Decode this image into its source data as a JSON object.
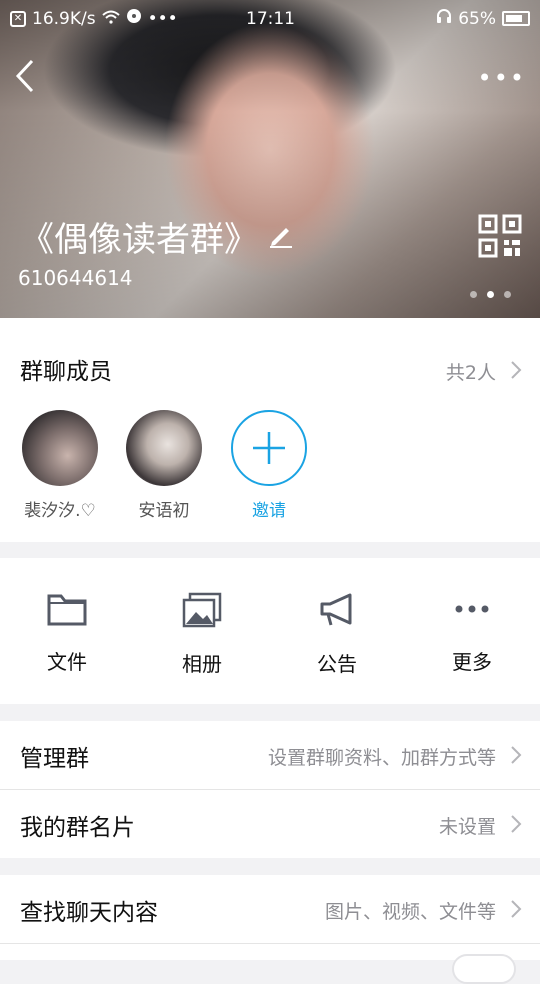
{
  "status_bar": {
    "speed": "16.9K/s",
    "dots": "•••",
    "time": "17:11",
    "battery": "65%"
  },
  "header": {
    "group_name": "《偶像读者群》",
    "group_id": "610644614"
  },
  "members": {
    "title": "群聊成员",
    "count": "共2人",
    "list": [
      {
        "name": "裴汐汐.♡"
      },
      {
        "name": "安语初"
      }
    ],
    "invite_label": "邀请"
  },
  "tools": [
    {
      "label": "文件"
    },
    {
      "label": "相册"
    },
    {
      "label": "公告"
    },
    {
      "label": "更多"
    }
  ],
  "rows": [
    {
      "title": "管理群",
      "value": "设置群聊资料、加群方式等"
    },
    {
      "title": "我的群名片",
      "value": "未设置"
    },
    {
      "title": "查找聊天内容",
      "value": "图片、视频、文件等"
    }
  ],
  "colors": {
    "accent": "#1aa3e3",
    "secondary_text": "#8e8e93",
    "background": "#f2f2f4"
  }
}
